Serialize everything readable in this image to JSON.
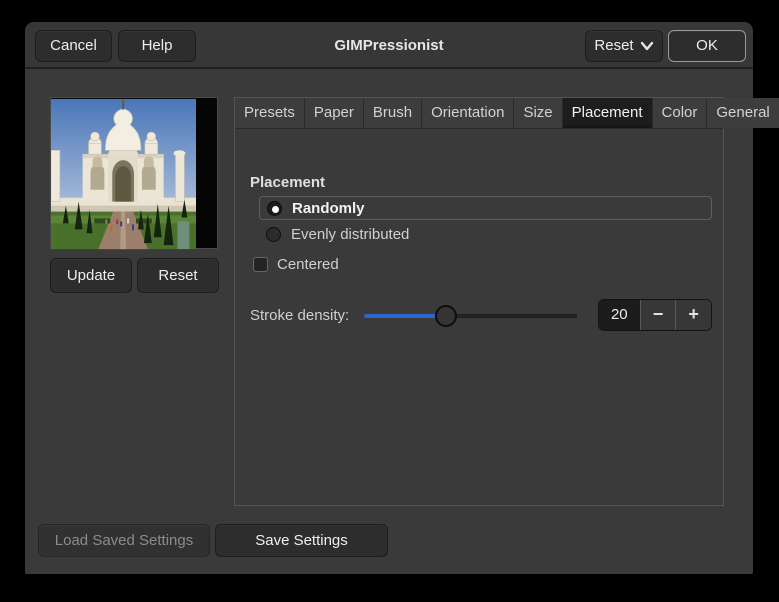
{
  "window": {
    "title": "GIMPressionist"
  },
  "header": {
    "cancel_label": "Cancel",
    "help_label": "Help",
    "reset_label": "Reset",
    "ok_label": "OK"
  },
  "tabs": {
    "items": [
      "Presets",
      "Paper",
      "Brush",
      "Orientation",
      "Size",
      "Placement",
      "Color",
      "General"
    ],
    "active": "Placement"
  },
  "preview": {
    "update_label": "Update",
    "reset_label": "Reset",
    "image_name": "taj-mahal-photo"
  },
  "placement": {
    "heading": "Placement",
    "options": [
      {
        "label": "Randomly",
        "selected": true
      },
      {
        "label": "Evenly distributed",
        "selected": false
      }
    ],
    "centered_label": "Centered",
    "centered_checked": false,
    "stroke_density": {
      "label": "Stroke density:",
      "value": "20",
      "percent": 38.5,
      "minus_glyph": "−",
      "plus_glyph": "+"
    }
  },
  "footer": {
    "load_label": "Load Saved Settings",
    "load_enabled": false,
    "save_label": "Save Settings"
  },
  "colors": {
    "accent_blue": "#2a66cc",
    "window_bg": "#3a3a3a",
    "active_tab_bg": "#1d1d1d",
    "button_bg": "#2d2d2d"
  }
}
